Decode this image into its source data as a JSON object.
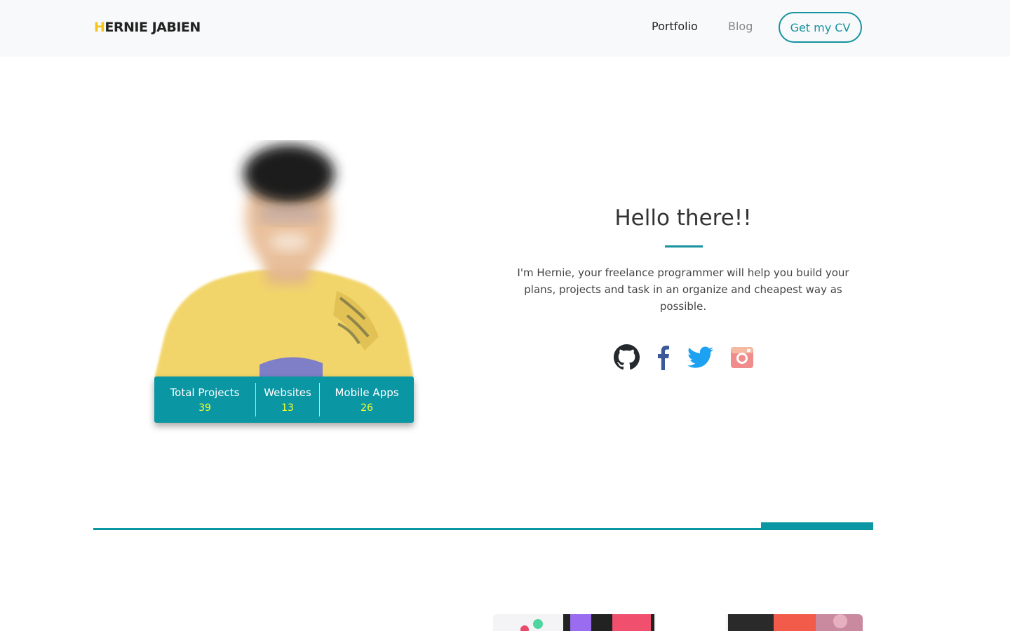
{
  "header": {
    "brand_first": "H",
    "brand_rest": "ERNIE JABIEN",
    "nav": {
      "portfolio": "Portfolio",
      "blog": "Blog"
    },
    "cta": "Get my CV"
  },
  "profile": {
    "portrait_icon": "profile-photo",
    "stats": [
      {
        "label": "Total Projects",
        "value": "39"
      },
      {
        "label": "Websites",
        "value": "13"
      },
      {
        "label": "Mobile Apps",
        "value": "26"
      }
    ]
  },
  "intro": {
    "title": "Hello there!!",
    "text": "I'm Hernie, your freelance programmer will help you build your plans, projects and task in an organize and cheapest way as possible."
  },
  "social": [
    {
      "name": "github",
      "icon": "github-icon"
    },
    {
      "name": "facebook",
      "icon": "facebook-icon"
    },
    {
      "name": "twitter",
      "icon": "twitter-icon"
    },
    {
      "name": "instagram",
      "icon": "instagram-icon"
    }
  ],
  "colors": {
    "accent": "#0b96a3",
    "brand_highlight": "#f5c518",
    "stat_value": "#f6ff2e",
    "header_bg": "#f8f9fa"
  }
}
